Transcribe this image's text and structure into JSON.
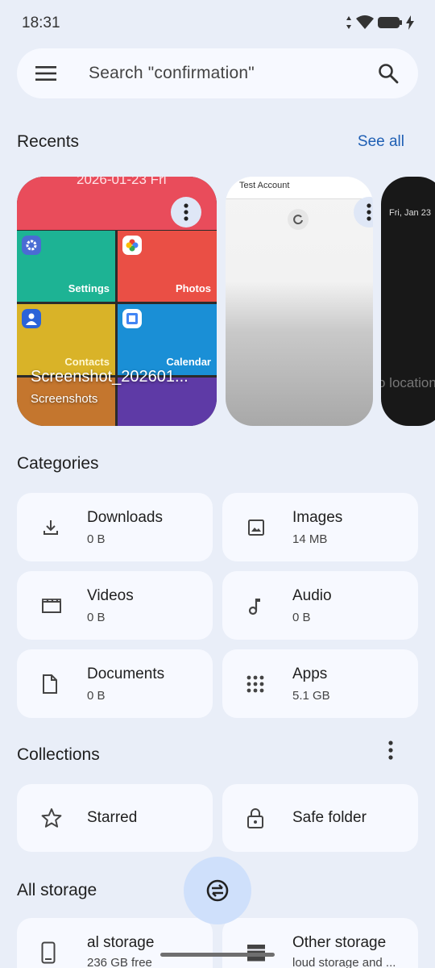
{
  "status_bar": {
    "time": "18:31"
  },
  "search": {
    "placeholder": "Search \"confirmation\""
  },
  "recents": {
    "title": "Recents",
    "see_all": "See all",
    "items": [
      {
        "top_date": "2026-01-23 Fri",
        "name": "Screenshot_202601...",
        "folder": "Screenshots",
        "tiles": [
          "Settings",
          "Photos",
          "Contacts",
          "Calendar"
        ]
      },
      {
        "header": "Test Account"
      },
      {
        "date": "Fri, Jan 23",
        "text": "o location"
      }
    ]
  },
  "categories": {
    "title": "Categories",
    "items": [
      {
        "label": "Downloads",
        "size": "0 B",
        "icon": "download-icon"
      },
      {
        "label": "Images",
        "size": "14 MB",
        "icon": "image-icon"
      },
      {
        "label": "Videos",
        "size": "0 B",
        "icon": "video-icon"
      },
      {
        "label": "Audio",
        "size": "0 B",
        "icon": "music-note-icon"
      },
      {
        "label": "Documents",
        "size": "0 B",
        "icon": "document-icon"
      },
      {
        "label": "Apps",
        "size": "5.1 GB",
        "icon": "apps-grid-icon"
      }
    ]
  },
  "collections": {
    "title": "Collections",
    "items": [
      {
        "label": "Starred",
        "icon": "star-icon"
      },
      {
        "label": "Safe folder",
        "icon": "lock-icon"
      }
    ]
  },
  "all_storage": {
    "title": "All storage",
    "items": [
      {
        "label": "al storage",
        "sub": "236 GB free",
        "icon": "phone-icon"
      },
      {
        "label": "Other storage",
        "sub": "loud storage and ...",
        "icon": "storage-icon"
      }
    ]
  },
  "colors": {
    "background": "#e9eef8",
    "card": "#f7f9ff",
    "accent": "#1f5fb4",
    "fab": "#cfe0fb"
  }
}
